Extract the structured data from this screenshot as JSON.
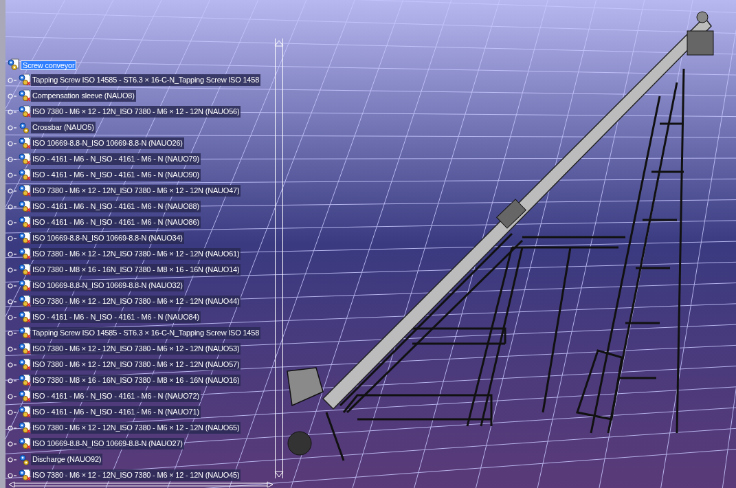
{
  "tree": {
    "root": {
      "label": "Screw conveyor",
      "selected": true,
      "children": [
        {
          "label": "Tapping Screw ISO 14585 - ST6.3 × 16-C-N_Tapping Screw ISO 1458",
          "kind": "part",
          "selected": false
        },
        {
          "label": "Compensation sleeve (NAUO8)",
          "kind": "part",
          "selected": false
        },
        {
          "label": "ISO 7380 - M6 × 12 - 12N_ISO 7380 - M6 × 12 - 12N (NAUO56)",
          "kind": "part",
          "selected": false
        },
        {
          "label": "Crossbar (NAUO5)",
          "kind": "product",
          "selected": false
        },
        {
          "label": "ISO 10669-8.8-N_ISO 10669-8.8-N (NAUO26)",
          "kind": "part",
          "selected": false
        },
        {
          "label": "ISO - 4161 - M6 - N_ISO - 4161 - M6 - N (NAUO79)",
          "kind": "part",
          "selected": false
        },
        {
          "label": "ISO - 4161 - M6 - N_ISO - 4161 - M6 - N (NAUO90)",
          "kind": "part",
          "selected": false
        },
        {
          "label": "ISO 7380 - M6 × 12 - 12N_ISO 7380 - M6 × 12 - 12N (NAUO47)",
          "kind": "part",
          "selected": false
        },
        {
          "label": "ISO - 4161 - M6 - N_ISO - 4161 - M6 - N (NAUO88)",
          "kind": "part",
          "selected": false
        },
        {
          "label": "ISO - 4161 - M6 - N_ISO - 4161 - M6 - N (NAUO86)",
          "kind": "part",
          "selected": false
        },
        {
          "label": "ISO 10669-8.8-N_ISO 10669-8.8-N (NAUO34)",
          "kind": "part",
          "selected": false
        },
        {
          "label": "ISO 7380 - M6 × 12 - 12N_ISO 7380 - M6 × 12 - 12N (NAUO61)",
          "kind": "part",
          "selected": false
        },
        {
          "label": "ISO 7380 - M8 × 16 - 16N_ISO 7380 - M8 × 16 - 16N (NAUO14)",
          "kind": "part",
          "selected": false
        },
        {
          "label": "ISO 10669-8.8-N_ISO 10669-8.8-N (NAUO32)",
          "kind": "part",
          "selected": false
        },
        {
          "label": "ISO 7380 - M6 × 12 - 12N_ISO 7380 - M6 × 12 - 12N (NAUO44)",
          "kind": "part",
          "selected": false
        },
        {
          "label": "ISO - 4161 - M6 - N_ISO - 4161 - M6 - N (NAUO84)",
          "kind": "part",
          "selected": false
        },
        {
          "label": "Tapping Screw ISO 14585 - ST6.3 × 16-C-N_Tapping Screw ISO 1458",
          "kind": "part",
          "selected": false
        },
        {
          "label": "ISO 7380 - M6 × 12 - 12N_ISO 7380 - M6 × 12 - 12N (NAUO53)",
          "kind": "part",
          "selected": false
        },
        {
          "label": "ISO 7380 - M6 × 12 - 12N_ISO 7380 - M6 × 12 - 12N (NAUO57)",
          "kind": "part",
          "selected": false
        },
        {
          "label": "ISO 7380 - M8 × 16 - 16N_ISO 7380 - M8 × 16 - 16N (NAUO16)",
          "kind": "part",
          "selected": false
        },
        {
          "label": "ISO - 4161 - M6 - N_ISO - 4161 - M6 - N (NAUO72)",
          "kind": "part",
          "selected": false
        },
        {
          "label": "ISO - 4161 - M6 - N_ISO - 4161 - M6 - N (NAUO71)",
          "kind": "part",
          "selected": false
        },
        {
          "label": "ISO 7380 - M6 × 12 - 12N_ISO 7380 - M6 × 12 - 12N (NAUO65)",
          "kind": "part",
          "selected": false
        },
        {
          "label": "ISO 10669-8.8-N_ISO 10669-8.8-N (NAUO27)",
          "kind": "part",
          "selected": false
        },
        {
          "label": "Discharge (NAUO92)",
          "kind": "product",
          "selected": false
        },
        {
          "label": "ISO 7380 - M6 × 12 - 12N_ISO 7380 - M6 × 12 - 12N (NAUO45)",
          "kind": "part",
          "selected": false
        }
      ]
    }
  }
}
